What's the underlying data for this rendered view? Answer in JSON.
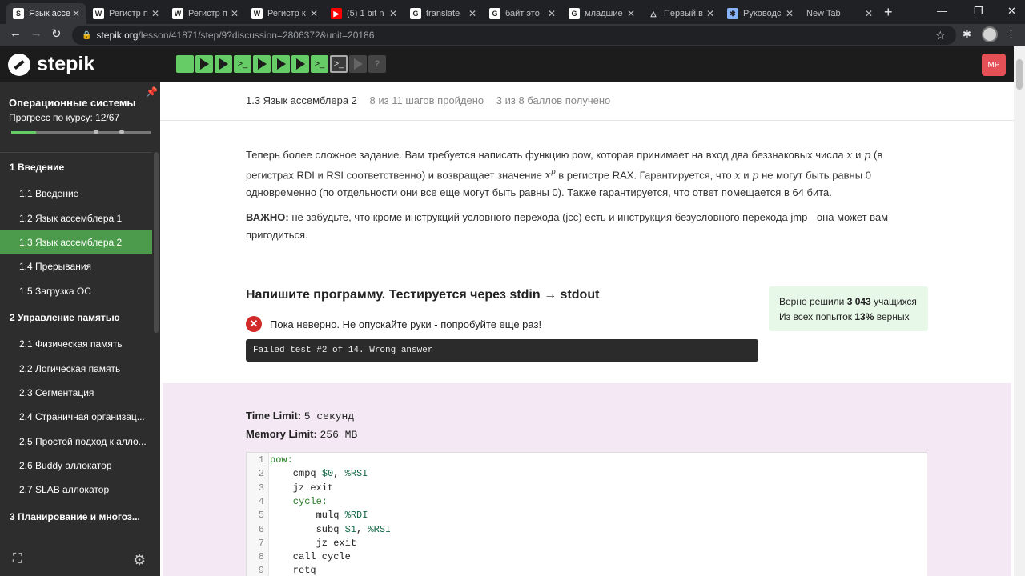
{
  "browser": {
    "tabs": [
      {
        "title": "Язык ассе",
        "icon": "stepik-icon",
        "color": "#fff"
      },
      {
        "title": "Регистр п",
        "icon": "wikipedia-icon",
        "color": "#fff"
      },
      {
        "title": "Регистр п",
        "icon": "wikipedia-icon",
        "color": "#fff"
      },
      {
        "title": "Регистр к",
        "icon": "wikipedia-icon",
        "color": "#fff"
      },
      {
        "title": "(5) 1 bit n",
        "icon": "youtube-icon",
        "color": "#ff0000"
      },
      {
        "title": "translate",
        "icon": "google-icon",
        "color": "#fff"
      },
      {
        "title": "байт это",
        "icon": "google-icon",
        "color": "#fff"
      },
      {
        "title": "младшие",
        "icon": "google-icon",
        "color": "#fff"
      },
      {
        "title": "Первый в",
        "icon": "drive-icon",
        "color": "#fff"
      },
      {
        "title": "Руководс",
        "icon": "guide-icon",
        "color": "#8ab4f8"
      },
      {
        "title": "New Tab",
        "icon": "",
        "color": ""
      }
    ],
    "url_host": "stepik.org",
    "url_path": "/lesson/41871/step/9?discussion=2806372&unit=20186"
  },
  "header": {
    "logo": "stepik",
    "user_initials": "MP",
    "steps": [
      "done",
      "play",
      "play",
      "code",
      "play",
      "play",
      "play",
      "code",
      "current",
      "todo",
      "todo-q"
    ]
  },
  "sidebar": {
    "course_title": "Операционные системы",
    "progress_label": "Прогресс по курсу:  12/67",
    "progress": 0.18,
    "items": [
      {
        "type": "mod",
        "label": "1  Введение"
      },
      {
        "type": "les",
        "label": "1.1  Введение"
      },
      {
        "type": "les",
        "label": "1.2  Язык ассемблера 1"
      },
      {
        "type": "les",
        "label": "1.3  Язык ассемблера 2",
        "selected": true
      },
      {
        "type": "les",
        "label": "1.4  Прерывания"
      },
      {
        "type": "les",
        "label": "1.5  Загрузка ОС"
      },
      {
        "type": "mod",
        "label": "2  Управление памятью"
      },
      {
        "type": "les",
        "label": "2.1  Физическая память"
      },
      {
        "type": "les",
        "label": "2.2  Логическая память"
      },
      {
        "type": "les",
        "label": "2.3  Сегментация"
      },
      {
        "type": "les",
        "label": "2.4  Страничная организац..."
      },
      {
        "type": "les",
        "label": "2.5  Простой подход к алло..."
      },
      {
        "type": "les",
        "label": "2.6  Buddy аллокатор"
      },
      {
        "type": "les",
        "label": "2.7  SLAB аллокатор"
      },
      {
        "type": "mod",
        "label": "3  Планирование и многоз..."
      }
    ]
  },
  "lesson": {
    "title": "1.3 Язык ассемблера 2",
    "steps_done": "8 из 11 шагов пройдено",
    "points": "3 из 8 баллов  получено",
    "text1_a": "Теперь более сложное задание. Вам требуется написать функцию pow, которая принимает на вход два беззнаковых числа ",
    "var_x": "x",
    "text1_and": " и ",
    "var_p": "p",
    "text1_b": " (в регистрах RDI и RSI соответственно) и возвращает значение ",
    "text1_c": " в регистре RAX. Гарантируется, что ",
    "text1_d": " не могут быть равны 0 одновременно (по отдельности они все еще могут быть равны 0). Также гарантируется, что ответ помещается в 64 бита.",
    "important_label": "ВАЖНО:",
    "important_text": " не забудьте, что кроме инструкций условного перехода (jcc) есть и инструкция безусловного перехода jmp - она может вам пригодиться.",
    "task_title": "Напишите программу. Тестируется через stdin → stdout",
    "status_text": "Пока неверно. Не опускайте руки - попробуйте еще раз!",
    "fail_message": "Failed test #2 of 14. Wrong answer",
    "stats_solved_a": "Верно решили ",
    "stats_solved_n": "3 043",
    "stats_solved_b": " учащихся",
    "stats_attempts_a": "Из всех попыток ",
    "stats_attempts_n": "13%",
    "stats_attempts_b": " верных",
    "time_limit_label": "Time Limit:",
    "time_limit": "5 секунд",
    "memory_limit_label": "Memory Limit:",
    "memory_limit": "256 MB"
  },
  "code": [
    {
      "n": "1",
      "text": "pow:"
    },
    {
      "n": "2",
      "text": "    cmpq $0, %RSI"
    },
    {
      "n": "3",
      "text": "    jz exit"
    },
    {
      "n": "4",
      "text": "    cycle:"
    },
    {
      "n": "5",
      "text": "        mulq %RDI"
    },
    {
      "n": "6",
      "text": "        subq $1, %RSI"
    },
    {
      "n": "7",
      "text": "        jz exit"
    },
    {
      "n": "8",
      "text": "    call cycle"
    },
    {
      "n": "9",
      "text": "    retq"
    }
  ]
}
